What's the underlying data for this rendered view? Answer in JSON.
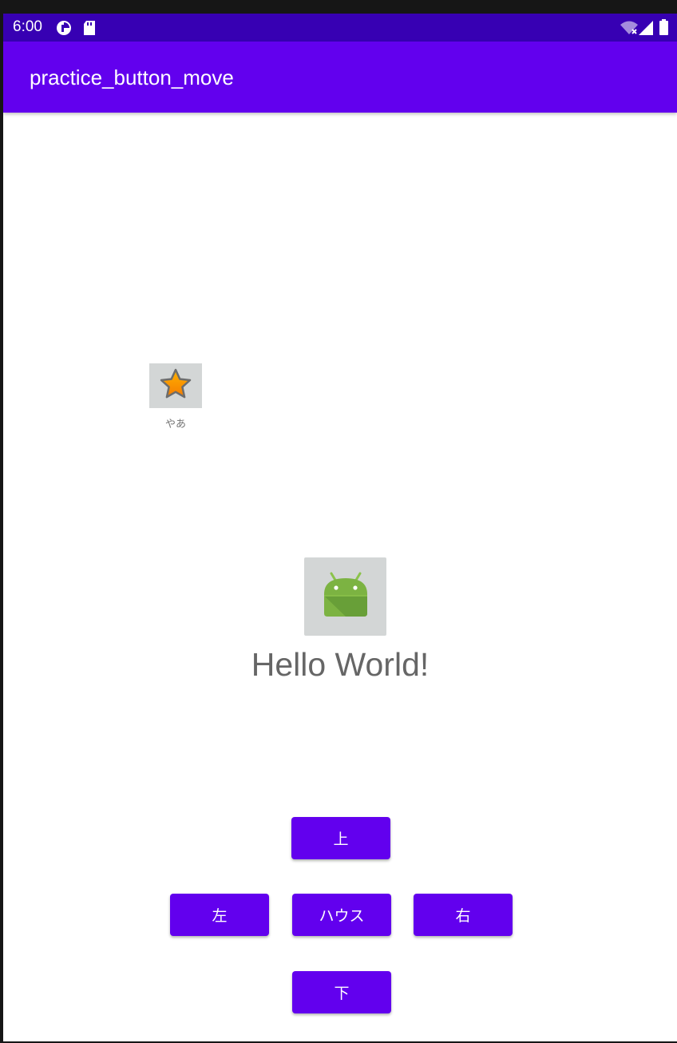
{
  "status_bar": {
    "time": "6:00",
    "icons": [
      "notification-icon",
      "sd-card-icon",
      "wifi-icon",
      "signal-icon",
      "battery-icon"
    ]
  },
  "app_bar": {
    "title": "practice_button_move",
    "color": "#6200ee",
    "status_color": "#3700b3"
  },
  "star_widget": {
    "icon": "star-icon",
    "label": "やあ"
  },
  "android_image": {
    "icon": "android-robot-icon"
  },
  "hello_text": "Hello World!",
  "buttons": {
    "up": "上",
    "left": "左",
    "house": "ハウス",
    "right": "右",
    "down": "下"
  }
}
